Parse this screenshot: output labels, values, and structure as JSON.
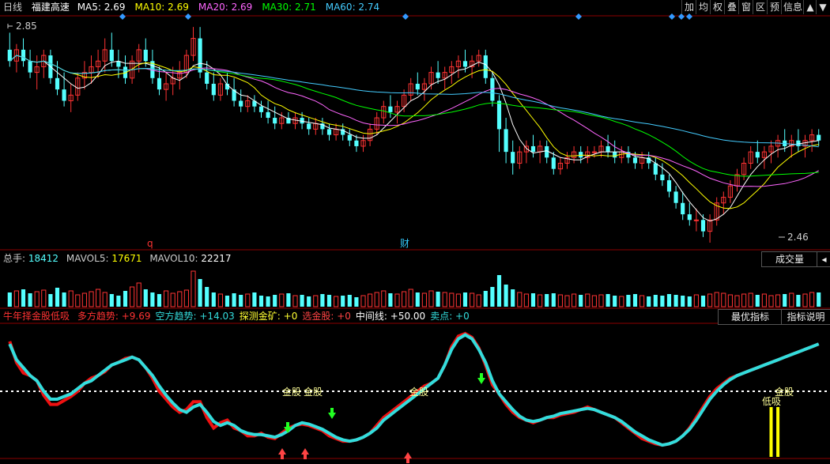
{
  "header": {
    "period": "日线",
    "stock_name": "福建高速",
    "ma": [
      {
        "label": "MA5",
        "value": "2.69",
        "color": "#ffffff"
      },
      {
        "label": "MA10",
        "value": "2.69",
        "color": "#ffff00"
      },
      {
        "label": "MA20",
        "value": "2.69",
        "color": "#ff66ff"
      },
      {
        "label": "MA30",
        "value": "2.71",
        "color": "#00ff00"
      },
      {
        "label": "MA60",
        "value": "2.74",
        "color": "#44ccff"
      }
    ],
    "toolbar": [
      "加",
      "均",
      "权",
      "叠",
      "窗",
      "区",
      "预",
      "信息",
      "▲",
      "▼"
    ]
  },
  "price_panel": {
    "max_label": "2.85",
    "min_label": "2.46",
    "marker_q": "q",
    "marker_cai": "财"
  },
  "volume_panel": {
    "label": "总手",
    "value": "18412",
    "mavol5_label": "MAVOL5",
    "mavol5_value": "17671",
    "mavol10_label": "MAVOL10",
    "mavol10_value": "22217",
    "dropdown": "成交量",
    "toggle": "◂"
  },
  "indicator_panel": {
    "name": "牛年择金股低吸",
    "items": [
      {
        "label": "多方趋势",
        "value": "+9.69",
        "color": "#ff3333"
      },
      {
        "label": "空方趋势",
        "value": "+14.03",
        "color": "#33dddd"
      },
      {
        "label": "探测金矿",
        "value": "+0",
        "color": "#ffff33"
      },
      {
        "label": "选金股",
        "value": "+0",
        "color": "#ff4444"
      },
      {
        "label": "中间线",
        "value": "+50.00",
        "color": "#ffffff"
      },
      {
        "label": "卖点",
        "value": "+0",
        "color": "#33dddd"
      }
    ],
    "btn_best": "最优指标",
    "btn_help": "指标说明",
    "signals": [
      "金股",
      "金股",
      "金股",
      "金股",
      "低吸"
    ]
  },
  "colors": {
    "up": "#ff3333",
    "down": "#54ffff",
    "grid": "#8b0000",
    "bull": "#ee1111",
    "bear": "#33dddd"
  },
  "chart_data": {
    "type": "candlestick",
    "bars": 120,
    "price_ylim": [
      2.46,
      2.85
    ],
    "ohlc": [
      [
        2.8,
        2.83,
        2.77,
        2.78
      ],
      [
        2.78,
        2.81,
        2.76,
        2.8
      ],
      [
        2.8,
        2.82,
        2.77,
        2.78
      ],
      [
        2.78,
        2.8,
        2.75,
        2.76
      ],
      [
        2.76,
        2.79,
        2.73,
        2.77
      ],
      [
        2.77,
        2.8,
        2.75,
        2.79
      ],
      [
        2.79,
        2.8,
        2.74,
        2.75
      ],
      [
        2.75,
        2.78,
        2.72,
        2.73
      ],
      [
        2.73,
        2.76,
        2.7,
        2.71
      ],
      [
        2.71,
        2.74,
        2.69,
        2.72
      ],
      [
        2.72,
        2.76,
        2.71,
        2.75
      ],
      [
        2.75,
        2.78,
        2.73,
        2.76
      ],
      [
        2.76,
        2.79,
        2.74,
        2.77
      ],
      [
        2.77,
        2.8,
        2.75,
        2.78
      ],
      [
        2.78,
        2.82,
        2.76,
        2.8
      ],
      [
        2.8,
        2.83,
        2.77,
        2.78
      ],
      [
        2.78,
        2.8,
        2.75,
        2.77
      ],
      [
        2.77,
        2.79,
        2.74,
        2.75
      ],
      [
        2.75,
        2.79,
        2.74,
        2.78
      ],
      [
        2.78,
        2.81,
        2.76,
        2.8
      ],
      [
        2.8,
        2.82,
        2.77,
        2.78
      ],
      [
        2.78,
        2.8,
        2.74,
        2.75
      ],
      [
        2.75,
        2.77,
        2.72,
        2.73
      ],
      [
        2.73,
        2.76,
        2.71,
        2.74
      ],
      [
        2.74,
        2.77,
        2.72,
        2.75
      ],
      [
        2.75,
        2.78,
        2.73,
        2.76
      ],
      [
        2.76,
        2.8,
        2.75,
        2.79
      ],
      [
        2.79,
        2.84,
        2.78,
        2.82
      ],
      [
        2.82,
        2.84,
        2.75,
        2.76
      ],
      [
        2.76,
        2.78,
        2.73,
        2.74
      ],
      [
        2.74,
        2.76,
        2.71,
        2.72
      ],
      [
        2.72,
        2.75,
        2.71,
        2.74
      ],
      [
        2.74,
        2.76,
        2.72,
        2.73
      ],
      [
        2.73,
        2.75,
        2.7,
        2.71
      ],
      [
        2.71,
        2.73,
        2.69,
        2.7
      ],
      [
        2.7,
        2.72,
        2.69,
        2.71
      ],
      [
        2.71,
        2.72,
        2.69,
        2.7
      ],
      [
        2.7,
        2.71,
        2.68,
        2.69
      ],
      [
        2.69,
        2.71,
        2.67,
        2.68
      ],
      [
        2.68,
        2.7,
        2.66,
        2.67
      ],
      [
        2.67,
        2.69,
        2.66,
        2.68
      ],
      [
        2.68,
        2.69,
        2.67,
        2.67
      ],
      [
        2.67,
        2.69,
        2.66,
        2.68
      ],
      [
        2.68,
        2.69,
        2.66,
        2.67
      ],
      [
        2.67,
        2.68,
        2.65,
        2.66
      ],
      [
        2.66,
        2.68,
        2.65,
        2.67
      ],
      [
        2.67,
        2.68,
        2.65,
        2.66
      ],
      [
        2.66,
        2.67,
        2.64,
        2.65
      ],
      [
        2.65,
        2.67,
        2.64,
        2.66
      ],
      [
        2.66,
        2.67,
        2.64,
        2.65
      ],
      [
        2.65,
        2.66,
        2.63,
        2.64
      ],
      [
        2.64,
        2.65,
        2.62,
        2.63
      ],
      [
        2.63,
        2.65,
        2.62,
        2.64
      ],
      [
        2.64,
        2.67,
        2.63,
        2.66
      ],
      [
        2.66,
        2.69,
        2.65,
        2.68
      ],
      [
        2.68,
        2.71,
        2.67,
        2.7
      ],
      [
        2.7,
        2.72,
        2.68,
        2.69
      ],
      [
        2.69,
        2.71,
        2.67,
        2.7
      ],
      [
        2.7,
        2.73,
        2.69,
        2.72
      ],
      [
        2.72,
        2.75,
        2.71,
        2.74
      ],
      [
        2.74,
        2.76,
        2.72,
        2.73
      ],
      [
        2.73,
        2.75,
        2.71,
        2.74
      ],
      [
        2.74,
        2.77,
        2.73,
        2.76
      ],
      [
        2.76,
        2.78,
        2.74,
        2.75
      ],
      [
        2.75,
        2.77,
        2.73,
        2.76
      ],
      [
        2.76,
        2.78,
        2.74,
        2.77
      ],
      [
        2.77,
        2.79,
        2.75,
        2.78
      ],
      [
        2.78,
        2.8,
        2.76,
        2.77
      ],
      [
        2.77,
        2.79,
        2.75,
        2.78
      ],
      [
        2.78,
        2.8,
        2.77,
        2.79
      ],
      [
        2.79,
        2.8,
        2.74,
        2.75
      ],
      [
        2.75,
        2.76,
        2.7,
        2.71
      ],
      [
        2.71,
        2.72,
        2.62,
        2.66
      ],
      [
        2.66,
        2.68,
        2.6,
        2.62
      ],
      [
        2.62,
        2.64,
        2.58,
        2.6
      ],
      [
        2.6,
        2.63,
        2.59,
        2.62
      ],
      [
        2.62,
        2.64,
        2.6,
        2.63
      ],
      [
        2.63,
        2.65,
        2.61,
        2.62
      ],
      [
        2.62,
        2.64,
        2.6,
        2.63
      ],
      [
        2.63,
        2.64,
        2.6,
        2.61
      ],
      [
        2.61,
        2.62,
        2.58,
        2.59
      ],
      [
        2.59,
        2.61,
        2.58,
        2.6
      ],
      [
        2.6,
        2.62,
        2.59,
        2.61
      ],
      [
        2.61,
        2.63,
        2.6,
        2.62
      ],
      [
        2.62,
        2.63,
        2.6,
        2.61
      ],
      [
        2.61,
        2.63,
        2.6,
        2.62
      ],
      [
        2.62,
        2.63,
        2.61,
        2.62
      ],
      [
        2.62,
        2.64,
        2.61,
        2.63
      ],
      [
        2.63,
        2.65,
        2.61,
        2.62
      ],
      [
        2.62,
        2.64,
        2.6,
        2.61
      ],
      [
        2.61,
        2.63,
        2.6,
        2.62
      ],
      [
        2.62,
        2.63,
        2.6,
        2.61
      ],
      [
        2.61,
        2.62,
        2.59,
        2.6
      ],
      [
        2.6,
        2.62,
        2.59,
        2.61
      ],
      [
        2.61,
        2.62,
        2.59,
        2.6
      ],
      [
        2.6,
        2.61,
        2.57,
        2.58
      ],
      [
        2.58,
        2.6,
        2.56,
        2.57
      ],
      [
        2.57,
        2.58,
        2.54,
        2.55
      ],
      [
        2.55,
        2.56,
        2.52,
        2.53
      ],
      [
        2.53,
        2.55,
        2.5,
        2.51
      ],
      [
        2.51,
        2.53,
        2.49,
        2.5
      ],
      [
        2.5,
        2.52,
        2.48,
        2.5
      ],
      [
        2.5,
        2.51,
        2.47,
        2.48
      ],
      [
        2.48,
        2.51,
        2.46,
        2.5
      ],
      [
        2.5,
        2.54,
        2.49,
        2.53
      ],
      [
        2.53,
        2.55,
        2.51,
        2.54
      ],
      [
        2.54,
        2.57,
        2.53,
        2.56
      ],
      [
        2.56,
        2.59,
        2.55,
        2.58
      ],
      [
        2.58,
        2.61,
        2.57,
        2.6
      ],
      [
        2.6,
        2.63,
        2.59,
        2.62
      ],
      [
        2.62,
        2.64,
        2.6,
        2.61
      ],
      [
        2.61,
        2.63,
        2.59,
        2.62
      ],
      [
        2.62,
        2.64,
        2.6,
        2.63
      ],
      [
        2.63,
        2.65,
        2.61,
        2.64
      ],
      [
        2.64,
        2.66,
        2.62,
        2.63
      ],
      [
        2.63,
        2.65,
        2.61,
        2.64
      ],
      [
        2.64,
        2.66,
        2.62,
        2.63
      ],
      [
        2.63,
        2.65,
        2.61,
        2.64
      ],
      [
        2.64,
        2.66,
        2.62,
        2.65
      ],
      [
        2.65,
        2.66,
        2.63,
        2.64
      ]
    ],
    "volume": [
      18,
      20,
      22,
      17,
      19,
      21,
      16,
      24,
      18,
      20,
      15,
      17,
      19,
      22,
      18,
      16,
      14,
      20,
      25,
      30,
      22,
      18,
      16,
      20,
      17,
      19,
      21,
      45,
      35,
      25,
      18,
      16,
      14,
      17,
      15,
      16,
      18,
      14,
      13,
      15,
      16,
      17,
      14,
      15,
      13,
      14,
      16,
      15,
      13,
      14,
      15,
      12,
      14,
      16,
      18,
      20,
      17,
      16,
      19,
      22,
      18,
      17,
      20,
      19,
      18,
      17,
      16,
      18,
      17,
      15,
      20,
      25,
      40,
      28,
      22,
      18,
      16,
      17,
      15,
      16,
      17,
      15,
      14,
      16,
      15,
      16,
      14,
      15,
      16,
      14,
      13,
      15,
      16,
      14,
      13,
      15,
      14,
      16,
      15,
      14,
      13,
      15,
      14,
      16,
      18,
      17,
      15,
      14,
      16,
      17,
      15,
      16,
      14,
      15,
      16,
      17,
      15,
      16,
      18,
      18
    ],
    "volume_ylim": [
      0,
      50
    ],
    "bull_trend": [
      88,
      72,
      64,
      62,
      58,
      47,
      40,
      40,
      43,
      46,
      50,
      56,
      60,
      62,
      65,
      70,
      72,
      75,
      76,
      74,
      68,
      60,
      50,
      44,
      38,
      34,
      36,
      42,
      42,
      30,
      22,
      26,
      28,
      22,
      20,
      16,
      16,
      18,
      15,
      14,
      18,
      22,
      24,
      25,
      24,
      22,
      20,
      16,
      14,
      12,
      12,
      13,
      15,
      18,
      24,
      30,
      34,
      38,
      42,
      46,
      50,
      54,
      56,
      60,
      70,
      84,
      92,
      94,
      91,
      83,
      70,
      55,
      48,
      40,
      34,
      30,
      28,
      26,
      28,
      30,
      30,
      32,
      33,
      34,
      36,
      38,
      36,
      34,
      32,
      30,
      26,
      22,
      18,
      14,
      12,
      10,
      9,
      10,
      12,
      16,
      22,
      30,
      38,
      46,
      52,
      56,
      60,
      62,
      64,
      66,
      68,
      70,
      72,
      74,
      76,
      78,
      80,
      82,
      84,
      86
    ],
    "bear_trend": [
      86,
      74,
      68,
      62,
      58,
      50,
      44,
      44,
      46,
      48,
      52,
      56,
      58,
      62,
      66,
      70,
      72,
      74,
      76,
      74,
      68,
      62,
      54,
      47,
      41,
      36,
      34,
      38,
      40,
      34,
      27,
      24,
      26,
      24,
      20,
      18,
      17,
      17,
      16,
      15,
      17,
      20,
      24,
      26,
      25,
      23,
      21,
      18,
      15,
      13,
      12,
      13,
      15,
      18,
      22,
      28,
      32,
      36,
      40,
      44,
      48,
      52,
      56,
      60,
      70,
      82,
      90,
      93,
      90,
      82,
      72,
      58,
      48,
      42,
      36,
      31,
      28,
      27,
      28,
      30,
      31,
      33,
      34,
      35,
      36,
      37,
      36,
      34,
      32,
      30,
      27,
      23,
      19,
      16,
      13,
      11,
      9,
      10,
      12,
      16,
      21,
      28,
      36,
      44,
      50,
      55,
      59,
      62,
      64,
      66,
      68,
      70,
      72,
      74,
      76,
      78,
      80,
      82,
      84,
      86
    ],
    "middle_line": 50,
    "ind_ylim": [
      0,
      100
    ]
  }
}
